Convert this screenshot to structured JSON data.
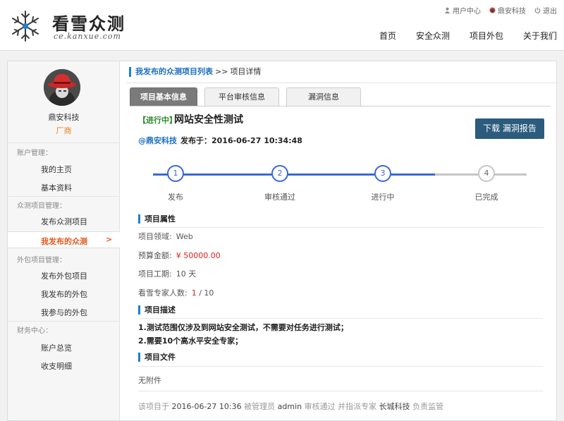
{
  "header": {
    "logo_text": "看雪众测",
    "logo_sub": "ce.kanxue.com",
    "top_links": [
      {
        "label": "用户中心",
        "icon": "user-icon"
      },
      {
        "label": "鼎安科技",
        "icon": "avatar-icon"
      },
      {
        "label": "退出",
        "icon": "power-icon"
      }
    ],
    "nav": [
      "首页",
      "安全众测",
      "项目外包",
      "关于我们"
    ]
  },
  "sidebar": {
    "user_name": "鼎安科技",
    "user_role": "厂商",
    "sections": [
      {
        "title": "账户管理：",
        "items": [
          "我的主页",
          "基本资料"
        ]
      },
      {
        "title": "众测项目管理：",
        "items": [
          "发布众测项目",
          "我发布的众测"
        ]
      },
      {
        "title": "外包项目管理：",
        "items": [
          "发布外包项目",
          "我发布的外包",
          "我参与的外包"
        ]
      },
      {
        "title": "财务中心：",
        "items": [
          "账户总览",
          "收支明细"
        ]
      }
    ],
    "active_arrow": ">"
  },
  "breadcrumb": {
    "parent": "我发布的众测项目列表",
    "sep": ">>",
    "current": "项目详情"
  },
  "tabs": [
    "项目基本信息",
    "平台审核信息",
    "漏洞信息"
  ],
  "project": {
    "status": "【进行中】",
    "title": "网站安全性测试",
    "publisher": "@鼎安科技",
    "published_label": "发布于：",
    "published_time": "2016-06-27 10:34:48",
    "download_label": "下载 漏洞报告"
  },
  "steps": {
    "items": [
      {
        "num": "1",
        "label": "发布",
        "done": true
      },
      {
        "num": "2",
        "label": "审核通过",
        "done": true
      },
      {
        "num": "3",
        "label": "进行中",
        "done": true
      },
      {
        "num": "4",
        "label": "已完成",
        "done": false
      }
    ],
    "active_color": "#3b68d8",
    "inactive_color": "#c6c6c6"
  },
  "attributes": {
    "heading": "项目属性",
    "field_label": "项目领域:",
    "field_value": "Web",
    "budget_label": "预算金额:",
    "budget_value": "¥ 50000.00",
    "period_label": "项目工期:",
    "period_value": "10 天",
    "experts_label": "看雪专家人数:",
    "experts_current": "1",
    "experts_total": "/ 10"
  },
  "description": {
    "heading": "项目描述",
    "lines": [
      "1.测试范围仅涉及到网站安全测试，不需要对任务进行测试；",
      "2.需要10个高水平安全专家；"
    ]
  },
  "files": {
    "heading": "项目文件",
    "empty_text": "无附件"
  },
  "footnote": {
    "p1": "该项目于",
    "time": "2016-06-27 10:36",
    "p2": "被管理员",
    "admin": "admin",
    "p3": "审核通过 并指派专家",
    "expert": "长城科技",
    "p4": "负责监管"
  },
  "colors": {
    "accent_blue": "#1f7fd1",
    "button": "#2b5b7d",
    "active_orange": "#e05a1e",
    "role_orange": "#e8831d",
    "status_green": "#2a8a2a",
    "money_red": "#e02020"
  }
}
